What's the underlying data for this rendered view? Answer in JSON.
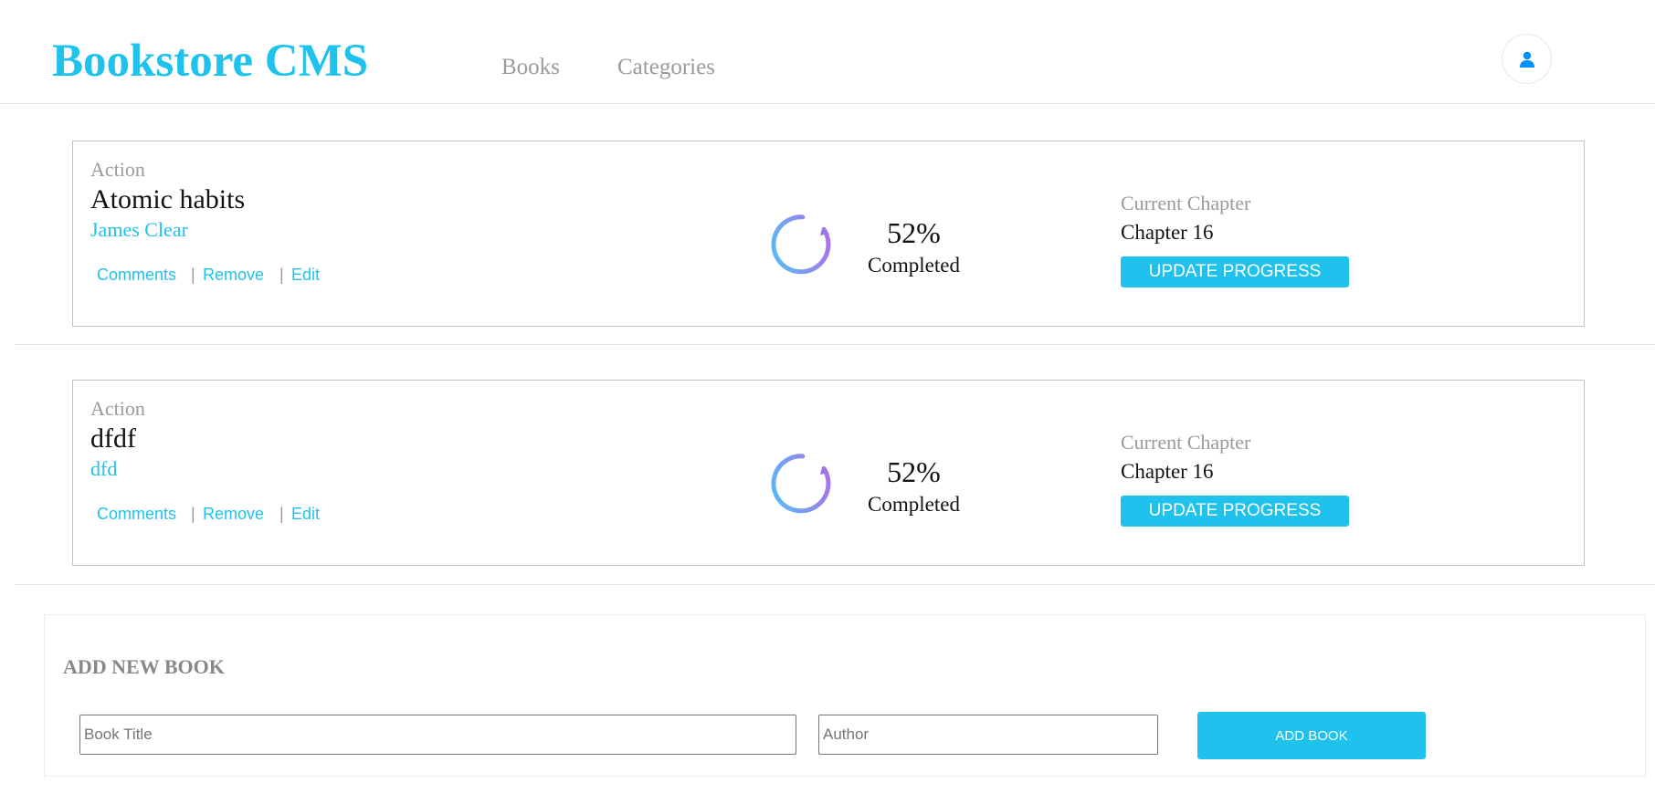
{
  "header": {
    "logo": "Bookstore CMS",
    "nav": [
      {
        "label": "Books"
      },
      {
        "label": "Categories"
      }
    ],
    "user_icon": "user-icon"
  },
  "books": [
    {
      "genre": "Action",
      "title": "Atomic habits",
      "author": "James Clear",
      "actions": {
        "comments": "Comments",
        "separator": "|",
        "remove": "Remove",
        "edit": "Edit"
      },
      "progress_percent": 52,
      "percent_label": "52%",
      "completed_label": "Completed",
      "chapter_label": "Current Chapter",
      "chapter_value": "Chapter 16",
      "update_label": "UPDATE PROGRESS"
    },
    {
      "genre": "Action",
      "title": "dfdf",
      "author": "dfd",
      "actions": {
        "comments": "Comments",
        "separator": "|",
        "remove": "Remove",
        "edit": "Edit"
      },
      "progress_percent": 52,
      "percent_label": "52%",
      "completed_label": "Completed",
      "chapter_label": "Current Chapter",
      "chapter_value": "Chapter 16",
      "update_label": "UPDATE PROGRESS"
    }
  ],
  "add_form": {
    "heading": "ADD NEW BOOK",
    "title_input": {
      "value": "",
      "placeholder": "Book Title"
    },
    "author_input": {
      "value": "",
      "placeholder": "Author"
    },
    "submit_label": "ADD BOOK"
  },
  "colors": {
    "accent": "#1ec2ec",
    "muted_text": "#9a9a9a",
    "progress_gradient_start": "#4fc3f7",
    "progress_gradient_end": "#b36ae8"
  }
}
